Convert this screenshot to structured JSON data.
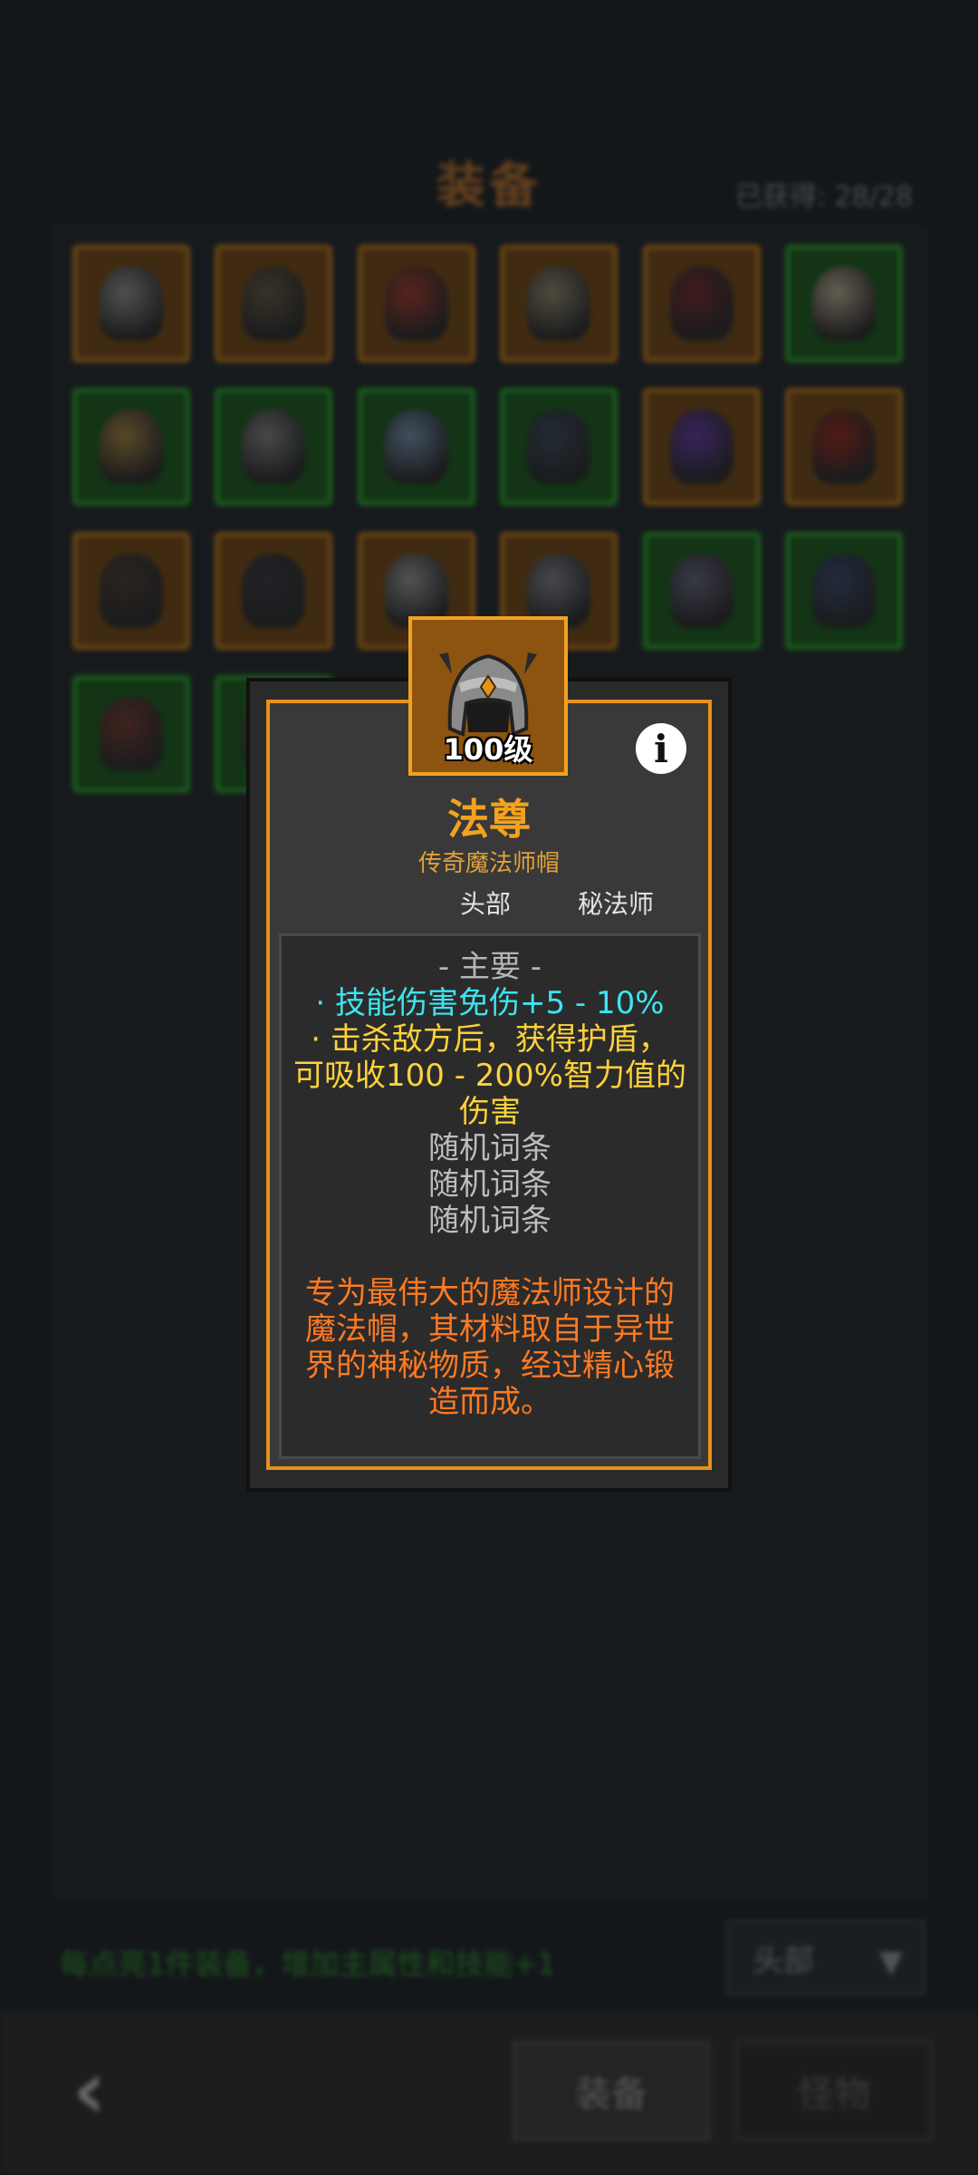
{
  "screen": {
    "title": "装备",
    "collected_label": "已获得: 28/28"
  },
  "grid": {
    "slots": [
      {
        "rarity": "rare",
        "icon": "knight-helmet-icon",
        "color": "#9a9a9a"
      },
      {
        "rarity": "rare",
        "icon": "horned-helmet-icon",
        "color": "#6a5a40"
      },
      {
        "rarity": "rare",
        "icon": "red-mask-icon",
        "color": "#b03a2a"
      },
      {
        "rarity": "rare",
        "icon": "gold-trim-helmet-icon",
        "color": "#9a9070"
      },
      {
        "rarity": "rare",
        "icon": "red-cap-icon",
        "color": "#7a2a2a"
      },
      {
        "rarity": "good",
        "icon": "pointed-hat-icon",
        "color": "#c8b89a"
      },
      {
        "rarity": "good",
        "icon": "gold-helmet-icon",
        "color": "#b08a40"
      },
      {
        "rarity": "good",
        "icon": "winged-helmet-icon",
        "color": "#8a8a8a"
      },
      {
        "rarity": "good",
        "icon": "blue-hood-icon",
        "color": "#7a9ab8"
      },
      {
        "rarity": "good",
        "icon": "dark-cap-icon",
        "color": "#3a4a5a"
      },
      {
        "rarity": "rare",
        "icon": "purple-hat-icon",
        "color": "#6a3ab0"
      },
      {
        "rarity": "rare",
        "icon": "red-hood-icon",
        "color": "#a02a1a"
      },
      {
        "rarity": "rare",
        "icon": "dark-helmet-icon",
        "color": "#4a3a30"
      },
      {
        "rarity": "rare",
        "icon": "black-hood-icon",
        "color": "#3a3a40"
      },
      {
        "rarity": "rare",
        "icon": "silver-helmet-icon",
        "color": "#a0a0a0"
      },
      {
        "rarity": "rare",
        "icon": "steel-helmet-icon",
        "color": "#8a8a90"
      },
      {
        "rarity": "good",
        "icon": "bat-helmet-icon",
        "color": "#6a6a80"
      },
      {
        "rarity": "good",
        "icon": "spiked-helmet-icon",
        "color": "#3a4a70"
      },
      {
        "rarity": "good",
        "icon": "demon-helmet-icon",
        "color": "#7a3a2a"
      },
      {
        "rarity": "good",
        "icon": "green-helmet-icon",
        "color": "#4a5a40"
      }
    ]
  },
  "bottom": {
    "tip": "每点亮1件装备，增加主属性和技能+1",
    "filter_label": "头部",
    "filter_arrow": "▼",
    "back_label": "‹",
    "tab_equipment": "装备",
    "tab_monster": "怪物"
  },
  "tooltip": {
    "level": "100级",
    "info_label": "i",
    "name": "法尊",
    "subtitle": "传奇魔法师帽",
    "slot": "头部",
    "class": "秘法师",
    "section_header": "- 主要 -",
    "affix_1": "· 技能伤害免伤+5 - 10%",
    "affix_2a": "· 击杀敌方后，获得护盾，",
    "affix_2b": "可吸收100 - 200%智力值的",
    "affix_2c": "伤害",
    "random_1": "随机词条",
    "random_2": "随机词条",
    "random_3": "随机词条",
    "desc_1": "专为最伟大的魔法师设计的",
    "desc_2": "魔法帽，其材料取自于异世",
    "desc_3": "界的神秘物质，经过精心锻",
    "desc_4": "造而成。",
    "frame_color": "#e8901a",
    "name_color": "#f2a21f"
  }
}
